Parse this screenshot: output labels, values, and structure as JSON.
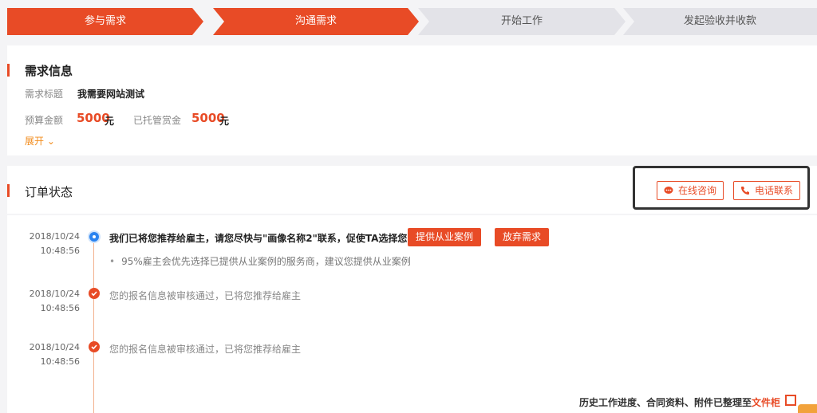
{
  "steps": [
    {
      "label": "参与需求",
      "active": true
    },
    {
      "label": "沟通需求",
      "active": true
    },
    {
      "label": "开始工作",
      "active": false
    },
    {
      "label": "发起验收并收款",
      "active": false
    }
  ],
  "requirement": {
    "title": "需求信息",
    "title_label": "需求标题",
    "title_value": "我需要网站测试",
    "budget_label": "预算金额",
    "budget_value": "5000",
    "budget_unit": "元",
    "escrow_label": "已托管赏金",
    "escrow_value": "5000",
    "escrow_unit": "元",
    "expand_label": "展开 ⌄"
  },
  "order": {
    "title": "订单状态",
    "online_consult": "在线咨询",
    "phone_contact": "电话联系"
  },
  "timeline": [
    {
      "date": "2018/10/24",
      "time": "10:48:56",
      "text": "我们已将您推荐给雇主，请您尽快与\"画像名称2\"联系，促使TA选择您",
      "sub": "95%雇主会优先选择已提供从业案例的服务商，建议您提供从业案例",
      "btn1": "提供从业案例",
      "btn2": "放弃需求"
    },
    {
      "date": "2018/10/24",
      "time": "10:48:56",
      "text": "您的报名信息被审核通过，已将您推荐给雇主"
    },
    {
      "date": "2018/10/24",
      "time": "10:48:56",
      "text": "您的报名信息被审核通过，已将您推荐给雇主"
    }
  ],
  "footer": {
    "note": "历史工作进度、合同资料、附件已整理至",
    "link": "文件柜"
  },
  "colors": {
    "accent": "#e84b26",
    "active_dot": "#2a83f0"
  }
}
